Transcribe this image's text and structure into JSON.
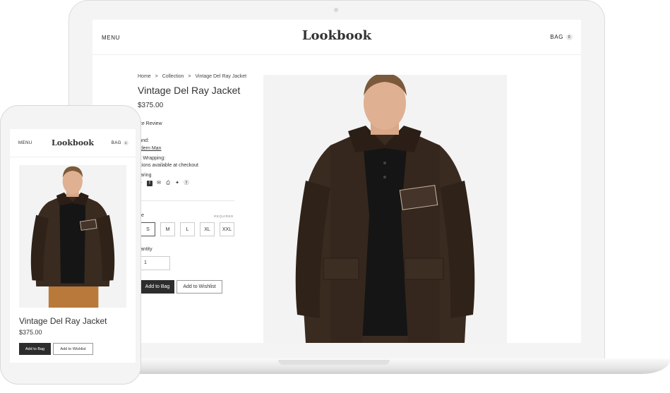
{
  "colors": {
    "accent_dark": "#2d2d2d",
    "jacket": "#3a2b20",
    "pants": "#b8793a"
  },
  "desktop": {
    "header": {
      "menu_label": "MENU",
      "logo": "Lookbook",
      "bag_label": "BAG",
      "bag_count": "0"
    },
    "breadcrumb": {
      "home": "Home",
      "sep": ">",
      "collection": "Collection",
      "current": "Vintage Del Ray Jacket"
    },
    "product": {
      "title": "Vintage Del Ray Jacket",
      "price": "$375.00",
      "write_review": "rite Review",
      "brand_label": "rand:",
      "brand_value": "odern Man",
      "gift_label": "ift Wrapping:",
      "gift_value": "ptions available at checkout",
      "sharing_label": "haring",
      "share_icons": [
        "plus-icon",
        "facebook-icon",
        "email-icon",
        "print-icon",
        "twitter-icon",
        "pinterest-icon"
      ],
      "size_label": "ize",
      "required_label": "REQUIRED",
      "sizes": [
        "S",
        "M",
        "L",
        "XL",
        "XXL"
      ],
      "selected_size": "S",
      "quantity_label": "uantity",
      "quantity_value": "1",
      "add_to_bag": "Add to Bag",
      "add_to_wishlist": "Add to Wishlist"
    }
  },
  "mobile": {
    "header": {
      "menu_label": "MENU",
      "logo": "Lookbook",
      "bag_label": "BAG",
      "bag_count": "0"
    },
    "product": {
      "title": "Vintage Del Ray Jacket",
      "price": "$375.00",
      "add_to_bag": "Add to Bag",
      "add_to_wishlist": "Add to Wishlist"
    }
  }
}
